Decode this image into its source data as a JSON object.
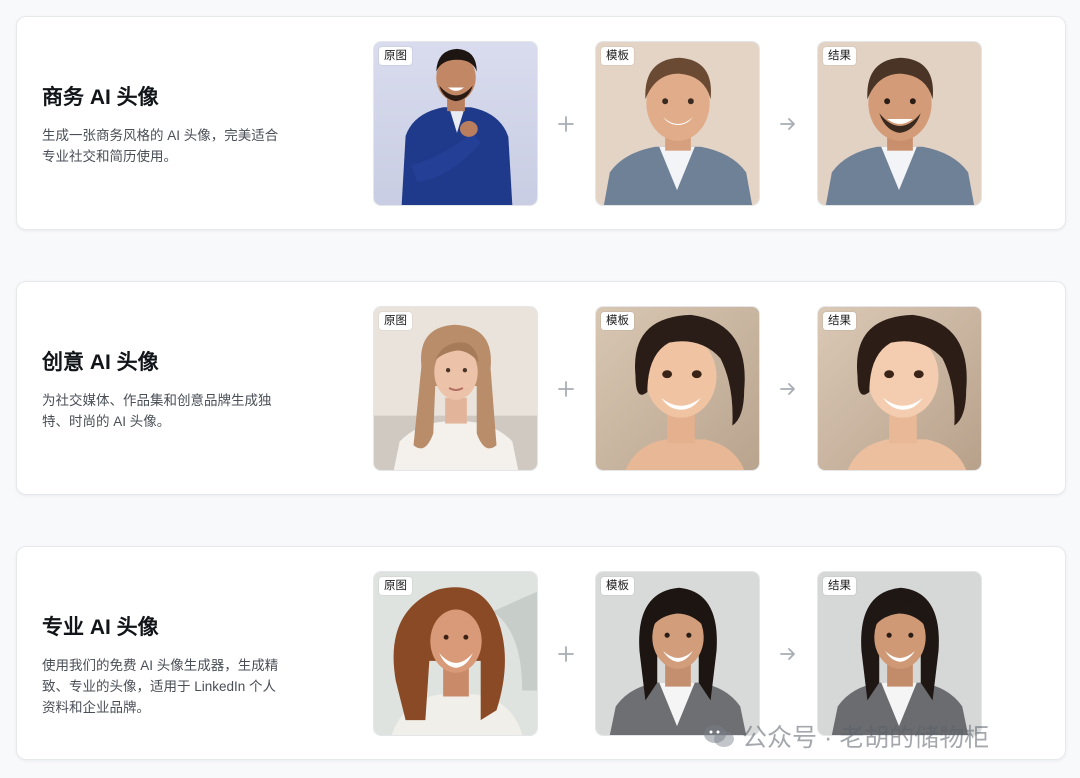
{
  "cards": [
    {
      "title": "商务 AI 头像",
      "description": "生成一张商务风格的 AI 头像，完美适合专业社交和简历使用。",
      "tiles": [
        {
          "label": "原图"
        },
        {
          "label": "模板"
        },
        {
          "label": "结果"
        }
      ]
    },
    {
      "title": "创意 AI 头像",
      "description": "为社交媒体、作品集和创意品牌生成独特、时尚的 AI 头像。",
      "tiles": [
        {
          "label": "原图"
        },
        {
          "label": "模板"
        },
        {
          "label": "结果"
        }
      ]
    },
    {
      "title": "专业 AI 头像",
      "description": "使用我们的免费 AI 头像生成器，生成精致、专业的头像，适用于 LinkedIn 个人资料和企业品牌。",
      "tiles": [
        {
          "label": "原图"
        },
        {
          "label": "模板"
        },
        {
          "label": "结果"
        }
      ]
    }
  ],
  "operators": {
    "plus_icon": "plus-icon",
    "arrow_icon": "arrow-right-icon"
  },
  "watermark": {
    "text": "公众号 · 老胡的储物柜",
    "icon": "wechat-icon"
  },
  "colors": {
    "card_bg": "#ffffff",
    "page_bg": "#f8f9fb",
    "title": "#111418",
    "description": "#4a4f57",
    "operator": "#a8adb5"
  }
}
